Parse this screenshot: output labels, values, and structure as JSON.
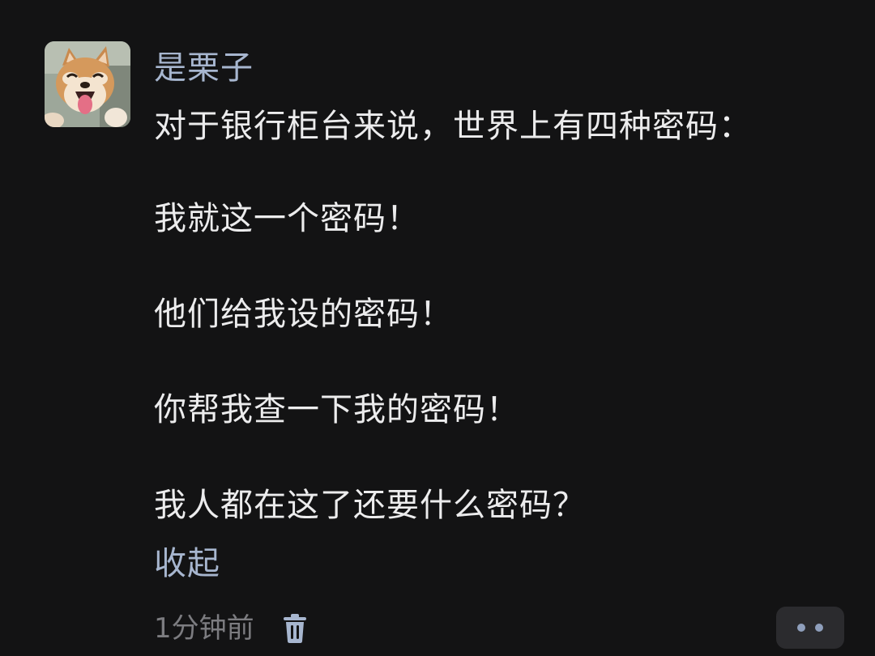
{
  "comment": {
    "username": "是栗子",
    "body_lines": [
      "对于银行柜台来说，世界上有四种密码：",
      "我就这一个密码！",
      "他们给我设的密码！",
      "你帮我查一下我的密码！",
      "我人都在这了还要什么密码？"
    ],
    "collapse_label": "收起",
    "timestamp": "1分钟前"
  },
  "icons": {
    "avatar": "shiba-dog-photo",
    "delete": "trash-icon",
    "more": "more-dots-icon"
  },
  "colors": {
    "background": "#131314",
    "username": "#a7b6cf",
    "body_text": "#ececed",
    "link": "#a7b6cf",
    "muted": "#7c7c80",
    "more_button_bg": "#2b2b2e",
    "more_dots": "#8f9fbc"
  }
}
